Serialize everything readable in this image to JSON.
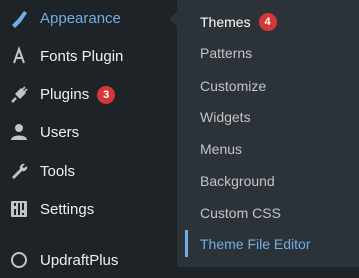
{
  "sidebar": {
    "items": [
      {
        "label": "Appearance",
        "icon": "paintbrush-icon",
        "active": true,
        "badge": null
      },
      {
        "label": "Fonts Plugin",
        "icon": "font-a-icon",
        "badge": null
      },
      {
        "label": "Plugins",
        "icon": "plug-icon",
        "badge": "3"
      },
      {
        "label": "Users",
        "icon": "user-icon",
        "badge": null
      },
      {
        "label": "Tools",
        "icon": "wrench-icon",
        "badge": null
      },
      {
        "label": "Settings",
        "icon": "sliders-icon",
        "badge": null
      },
      {
        "label": "UpdraftPlus",
        "icon": "updraft-icon",
        "badge": null
      }
    ]
  },
  "submenu": {
    "items": [
      {
        "label": "Themes",
        "badge": "4"
      },
      {
        "label": "Patterns"
      },
      {
        "label": "Customize"
      },
      {
        "label": "Widgets"
      },
      {
        "label": "Menus"
      },
      {
        "label": "Background"
      },
      {
        "label": "Custom CSS"
      },
      {
        "label": "Theme File Editor",
        "current": true
      }
    ]
  },
  "colors": {
    "sidebar_bg": "#1d2327",
    "submenu_bg": "#2c3338",
    "accent": "#72aee6",
    "badge": "#d63638"
  }
}
